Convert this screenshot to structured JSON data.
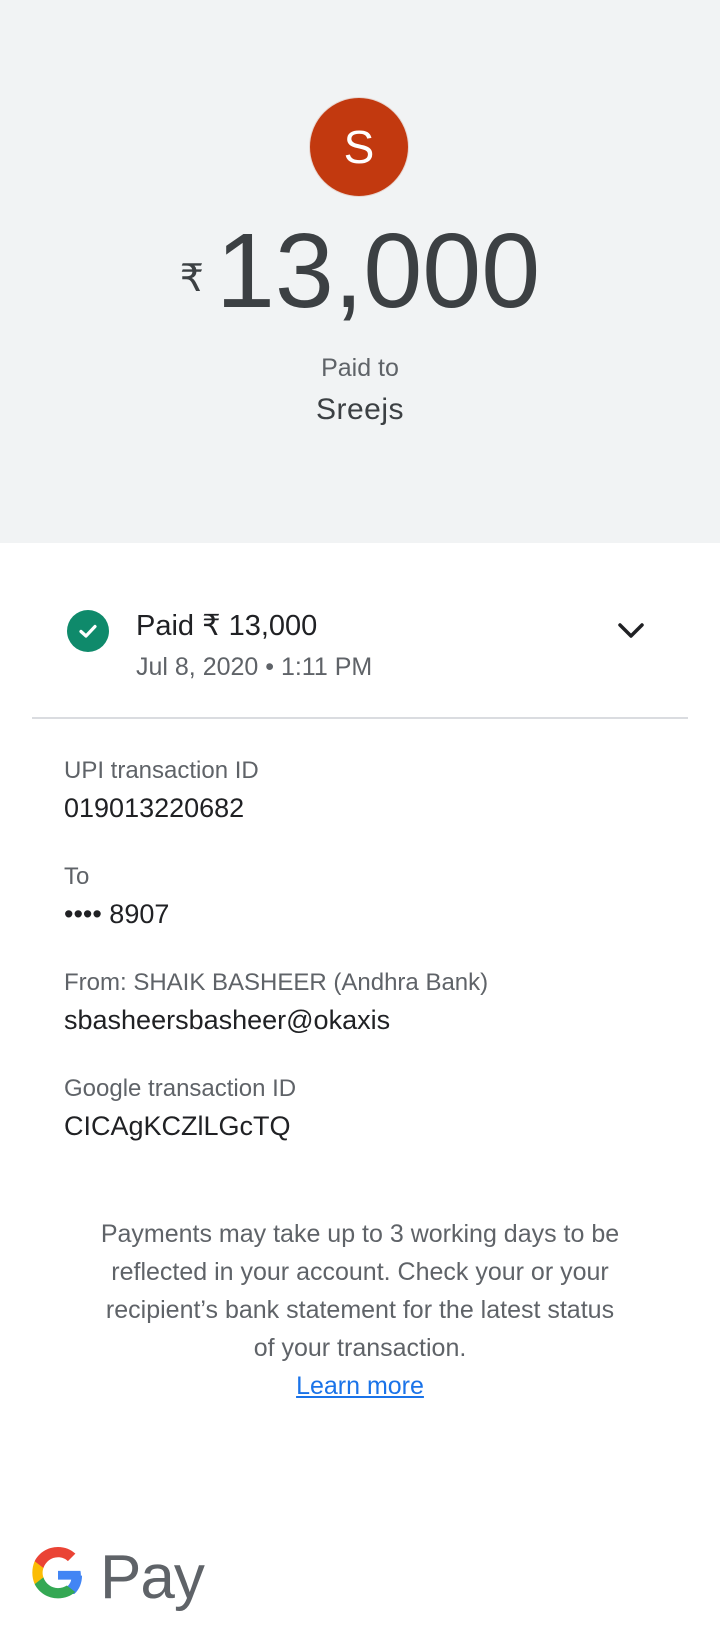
{
  "header": {
    "avatar_letter": "S",
    "currency_symbol": "₹",
    "amount": "13,000",
    "paid_to_label": "Paid to",
    "payee_name": "Sreejs"
  },
  "status": {
    "title": "Paid ₹ 13,000",
    "date": "Jul 8, 2020 • 1:11 PM",
    "check_icon": "check-circle-icon",
    "expand_icon": "chevron-down-icon",
    "check_color": "#0f8a6b"
  },
  "details": [
    {
      "label": "UPI transaction ID",
      "value": "019013220682"
    },
    {
      "label": "To",
      "value": "•••• 8907"
    },
    {
      "label": "From: SHAIK BASHEER (Andhra Bank)",
      "value": "sbasheersbasheer@okaxis"
    },
    {
      "label": "Google transaction ID",
      "value": "CICAgKCZlLGcTQ"
    }
  ],
  "note": {
    "text": "Payments may take up to 3 working days to be reflected in your account. Check your or your recipient’s bank statement for the latest status of your transaction.",
    "link": "Learn more"
  },
  "footer": {
    "logo_text": "Pay",
    "logo_icon": "google-g-icon"
  },
  "colors": {
    "avatar": "#c2390f",
    "hero_background": "#f1f3f4",
    "link": "#1a73e8"
  }
}
